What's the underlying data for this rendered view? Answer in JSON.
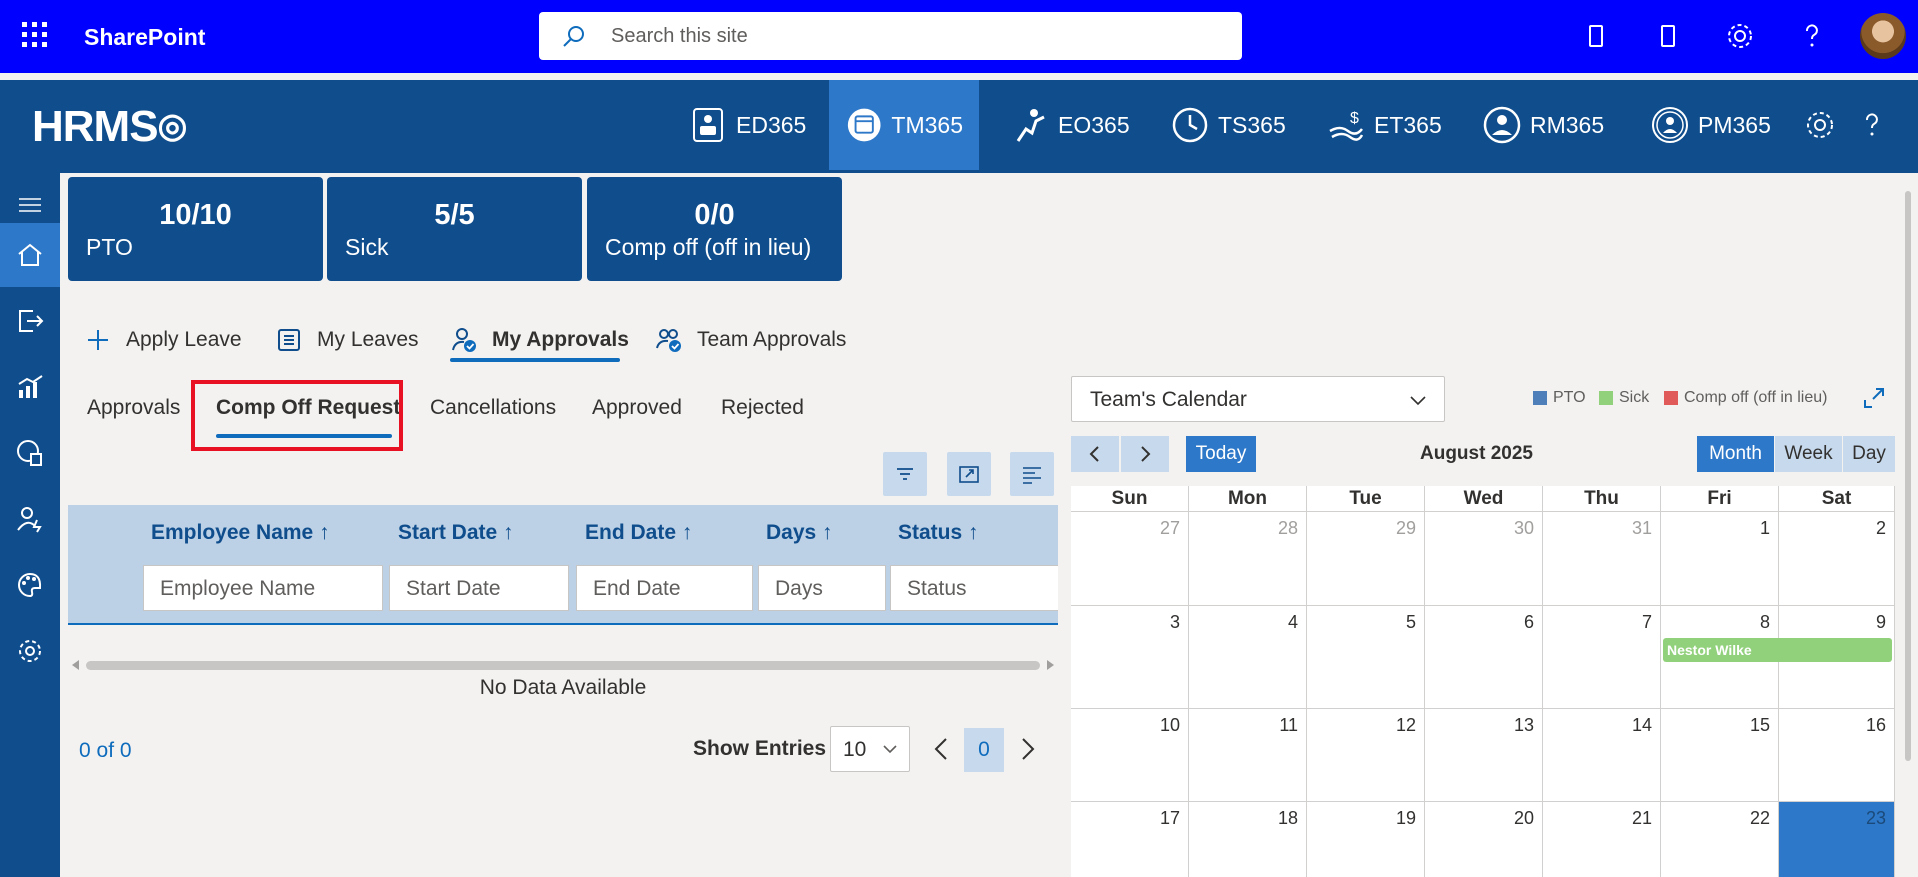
{
  "sharepoint": {
    "title": "SharePoint",
    "search_placeholder": "Search this site"
  },
  "hrms": {
    "logo": "HRMS",
    "nav": [
      {
        "label": "ED365",
        "icon": "employee-directory-icon"
      },
      {
        "label": "TM365",
        "icon": "time-management-icon",
        "active": true
      },
      {
        "label": "EO365",
        "icon": "onboarding-icon"
      },
      {
        "label": "TS365",
        "icon": "timesheet-icon"
      },
      {
        "label": "ET365",
        "icon": "expense-icon"
      },
      {
        "label": "RM365",
        "icon": "resource-icon"
      },
      {
        "label": "PM365",
        "icon": "performance-icon"
      }
    ]
  },
  "tiles": [
    {
      "value": "10/10",
      "label": "PTO"
    },
    {
      "value": "5/5",
      "label": "Sick"
    },
    {
      "value": "0/0",
      "label": "Comp off (off in lieu)"
    }
  ],
  "main_tabs": [
    {
      "label": "Apply Leave",
      "icon": "plus-icon"
    },
    {
      "label": "My Leaves",
      "icon": "list-icon"
    },
    {
      "label": "My Approvals",
      "icon": "person-check-icon",
      "active": true
    },
    {
      "label": "Team Approvals",
      "icon": "people-check-icon"
    }
  ],
  "sub_tabs": [
    {
      "label": "Approvals"
    },
    {
      "label": "Comp Off Request",
      "active": true
    },
    {
      "label": "Cancellations"
    },
    {
      "label": "Approved"
    },
    {
      "label": "Rejected"
    }
  ],
  "grid": {
    "columns": [
      {
        "header": "Employee Name ↑",
        "filter_placeholder": "Employee Name"
      },
      {
        "header": "Start Date ↑",
        "filter_placeholder": "Start Date"
      },
      {
        "header": "End Date ↑",
        "filter_placeholder": "End Date"
      },
      {
        "header": "Days ↑",
        "filter_placeholder": "Days"
      },
      {
        "header": "Status ↑",
        "filter_placeholder": "Status"
      }
    ],
    "empty_text": "No Data Available",
    "record_count": "0 of 0",
    "show_entries_label": "Show Entries",
    "page_size": "10",
    "current_page": "0"
  },
  "calendar": {
    "selector": "Team's Calendar",
    "legend": [
      {
        "label": "PTO",
        "color": "#4f7fb8"
      },
      {
        "label": "Sick",
        "color": "#92d17c"
      },
      {
        "label": "Comp off (off in lieu)",
        "color": "#e05a5a"
      }
    ],
    "today_label": "Today",
    "month_label": "August 2025",
    "views": [
      {
        "label": "Month",
        "active": true
      },
      {
        "label": "Week"
      },
      {
        "label": "Day"
      }
    ],
    "weekdays": [
      "Sun",
      "Mon",
      "Tue",
      "Wed",
      "Thu",
      "Fri",
      "Sat"
    ],
    "weeks": [
      [
        {
          "d": "27",
          "other": true
        },
        {
          "d": "28",
          "other": true
        },
        {
          "d": "29",
          "other": true
        },
        {
          "d": "30",
          "other": true
        },
        {
          "d": "31",
          "other": true
        },
        {
          "d": "1"
        },
        {
          "d": "2"
        }
      ],
      [
        {
          "d": "3"
        },
        {
          "d": "4"
        },
        {
          "d": "5"
        },
        {
          "d": "6"
        },
        {
          "d": "7"
        },
        {
          "d": "8"
        },
        {
          "d": "9"
        }
      ],
      [
        {
          "d": "10"
        },
        {
          "d": "11"
        },
        {
          "d": "12"
        },
        {
          "d": "13"
        },
        {
          "d": "14"
        },
        {
          "d": "15"
        },
        {
          "d": "16"
        }
      ],
      [
        {
          "d": "17"
        },
        {
          "d": "18"
        },
        {
          "d": "19"
        },
        {
          "d": "20"
        },
        {
          "d": "21"
        },
        {
          "d": "22"
        },
        {
          "d": "23",
          "today": true
        }
      ]
    ],
    "events": [
      {
        "title": "Nestor Wilke",
        "type": "Sick",
        "start": "8",
        "end": "9"
      }
    ]
  }
}
